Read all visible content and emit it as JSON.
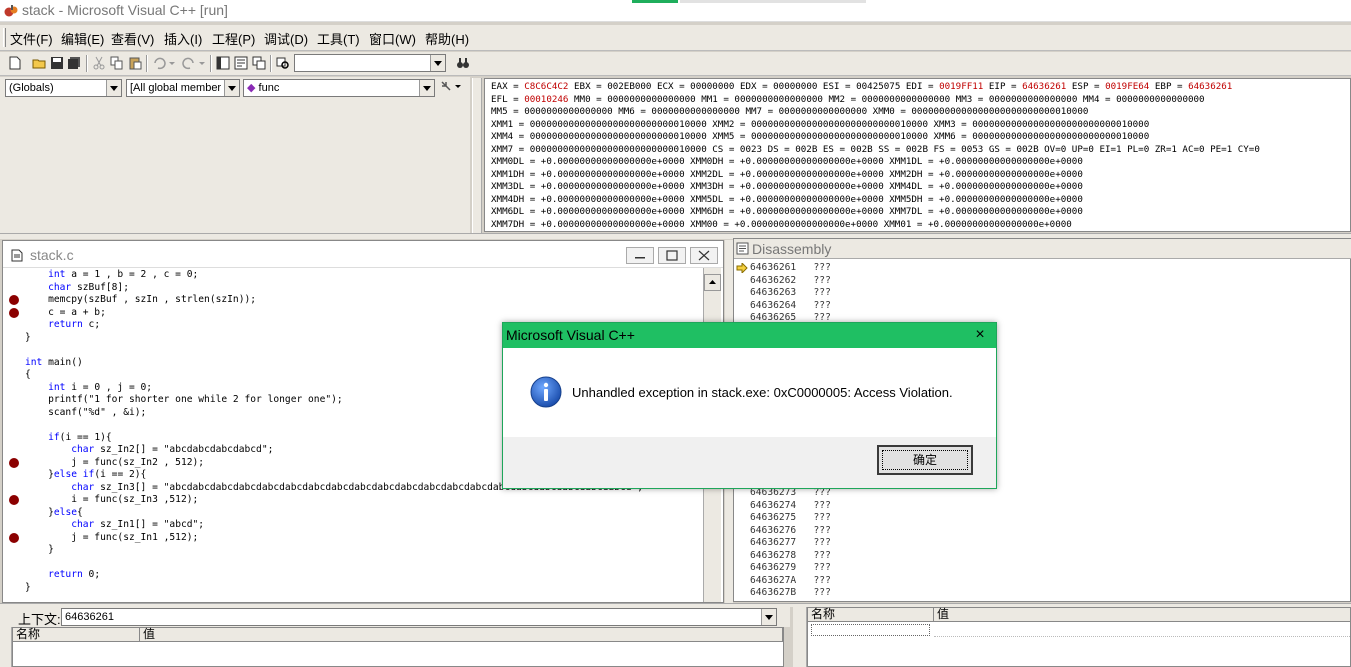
{
  "window": {
    "title": "stack - Microsoft Visual C++ [run]"
  },
  "menu": [
    "文件(F)",
    "编辑(E)",
    "查看(V)",
    "插入(I)",
    "工程(P)",
    "调试(D)",
    "工具(T)",
    "窗口(W)",
    "帮助(H)"
  ],
  "toolbar": {
    "find_value": ""
  },
  "wizardbar": {
    "class_combo": "(Globals)",
    "filter_combo": "[All global member",
    "function_combo": "func"
  },
  "registers": {
    "lines": [
      [
        [
          "EAX = ",
          0
        ],
        [
          "C8C6C4C2",
          1
        ],
        [
          " EBX = 002EB000 ECX = 00000000 EDX = 00000000 ESI = 00425075 EDI = ",
          0
        ],
        [
          "0019FF11",
          1
        ],
        [
          " EIP = ",
          0
        ],
        [
          "64636261",
          1
        ],
        [
          " ESP = ",
          0
        ],
        [
          "0019FE64",
          1
        ],
        [
          " EBP = ",
          0
        ],
        [
          "64636261",
          1
        ]
      ],
      [
        [
          "EFL = ",
          0
        ],
        [
          "00010246",
          1
        ],
        [
          " MM0 = 0000000000000000 MM1 = 0000000000000000 MM2 = 0000000000000000 MM3 = 0000000000000000 MM4 = 0000000000000000",
          0
        ]
      ],
      [
        [
          "MM5 = 0000000000000000 MM6 = 0000000000000000 MM7 = 0000000000000000 XMM0 = 00000000000000000000000000010000",
          0
        ]
      ],
      [
        [
          "XMM1 = 00000000000000000000000000010000 XMM2 = 00000000000000000000000000010000 XMM3 = 00000000000000000000000000010000",
          0
        ]
      ],
      [
        [
          "XMM4 = 00000000000000000000000000010000 XMM5 = 00000000000000000000000000010000 XMM6 = 00000000000000000000000000010000",
          0
        ]
      ],
      [
        [
          "XMM7 = 00000000000000000000000000010000 CS = 0023 DS = 002B ES = 002B SS = 002B FS = 0053 GS = 002B OV=0 UP=0 EI=1 PL=0 ZR=1 AC=0 PE=1 CY=0",
          0
        ]
      ],
      [
        [
          "XMM0DL = +0.00000000000000000e+0000 XMM0DH = +0.00000000000000000e+0000 XMM1DL = +0.00000000000000000e+0000",
          0
        ]
      ],
      [
        [
          "XMM1DH = +0.00000000000000000e+0000 XMM2DL = +0.00000000000000000e+0000 XMM2DH = +0.00000000000000000e+0000",
          0
        ]
      ],
      [
        [
          "XMM3DL = +0.00000000000000000e+0000 XMM3DH = +0.00000000000000000e+0000 XMM4DL = +0.00000000000000000e+0000",
          0
        ]
      ],
      [
        [
          "XMM4DH = +0.00000000000000000e+0000 XMM5DL = +0.00000000000000000e+0000 XMM5DH = +0.00000000000000000e+0000",
          0
        ]
      ],
      [
        [
          "XMM6DL = +0.00000000000000000e+0000 XMM6DH = +0.00000000000000000e+0000 XMM7DL = +0.00000000000000000e+0000",
          0
        ]
      ],
      [
        [
          "XMM7DH = +0.00000000000000000e+0000 XMM00 = +0.00000000000000000e+0000 XMM01 = +0.00000000000000000e+0000",
          0
        ]
      ]
    ]
  },
  "code_window": {
    "title": "stack.c",
    "lines": [
      {
        "text": "    int a = 1 , b = 2 , c = 0;",
        "bp": false
      },
      {
        "text": "    char szBuf[8];",
        "bp": false
      },
      {
        "text": "    memcpy(szBuf , szIn , strlen(szIn));",
        "bp": true
      },
      {
        "text": "    c = a + b;",
        "bp": true
      },
      {
        "text": "    return c;",
        "bp": false
      },
      {
        "text": "}",
        "bp": false
      },
      {
        "text": "",
        "bp": false
      },
      {
        "text": "int main()",
        "bp": false
      },
      {
        "text": "{",
        "bp": false
      },
      {
        "text": "    int i = 0 , j = 0;",
        "bp": false
      },
      {
        "text": "    printf(\"1 for shorter one while 2 for longer one\");",
        "bp": false
      },
      {
        "text": "    scanf(\"%d\" , &i);",
        "bp": false
      },
      {
        "text": "",
        "bp": false
      },
      {
        "text": "    if(i == 1){",
        "bp": false
      },
      {
        "text": "        char sz_In2[] = \"abcdabcdabcdabcd\";",
        "bp": false
      },
      {
        "text": "        j = func(sz_In2 , 512);",
        "bp": true
      },
      {
        "text": "    }else if(i == 2){",
        "bp": false
      },
      {
        "text": "        char sz_In3[] = \"abcdabcdabcdabcdabcdabcdabcdabcdabcdabcdabcdabcdabcdabcdabcdabcdabcdabcdabcdabcd\";",
        "bp": false
      },
      {
        "text": "        i = func(sz_In3 ,512);",
        "bp": true
      },
      {
        "text": "    }else{",
        "bp": false
      },
      {
        "text": "        char sz_In1[] = \"abcd\";",
        "bp": false
      },
      {
        "text": "        j = func(sz_In1 ,512);",
        "bp": true
      },
      {
        "text": "    }",
        "bp": false
      },
      {
        "text": "",
        "bp": false
      },
      {
        "text": "    return 0;",
        "bp": false
      },
      {
        "text": "}",
        "bp": false
      }
    ]
  },
  "disassembly": {
    "title": "Disassembly",
    "top_lines": [
      "64636261   ???",
      "64636262   ???",
      "64636263   ???",
      "64636264   ???",
      "64636265   ???"
    ],
    "bottom_lines": [
      "64636273   ???",
      "64636274   ???",
      "64636275   ???",
      "64636276   ???",
      "64636277   ???",
      "64636278   ???",
      "64636279   ???",
      "6463627A   ???",
      "6463627B   ???"
    ]
  },
  "context": {
    "label": "上下文:",
    "value": "64636261"
  },
  "variables": {
    "col_name": "名称",
    "col_value": "值"
  },
  "watch": {
    "col_name": "名称",
    "col_value": "值"
  },
  "dialog": {
    "title": "Microsoft Visual C++",
    "message": "Unhandled exception in stack.exe: 0xC0000005: Access Violation.",
    "ok_label": "确定",
    "close_glyph": "×"
  }
}
